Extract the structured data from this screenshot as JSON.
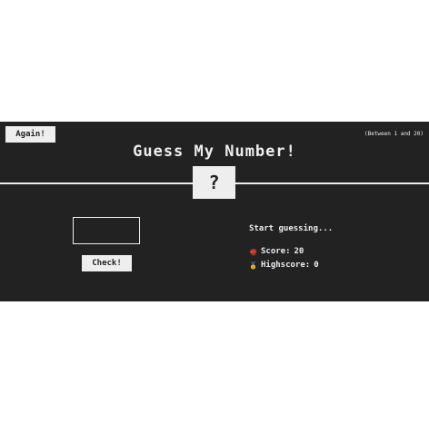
{
  "header": {
    "again_label": "Again!",
    "range_hint": "(Between 1 and 20)",
    "title": "Guess My Number!",
    "secret_number": "?"
  },
  "left": {
    "guess_value": "",
    "check_label": "Check!"
  },
  "right": {
    "message": "Start guessing...",
    "score_label": "Score:",
    "score_value": "20",
    "highscore_label": "Highscore:",
    "highscore_value": "0",
    "score_icon": "boxing-glove-icon",
    "highscore_icon": "medal-icon"
  },
  "colors": {
    "background": "#222222",
    "foreground": "#eeeeee",
    "page": "#ffffff"
  }
}
